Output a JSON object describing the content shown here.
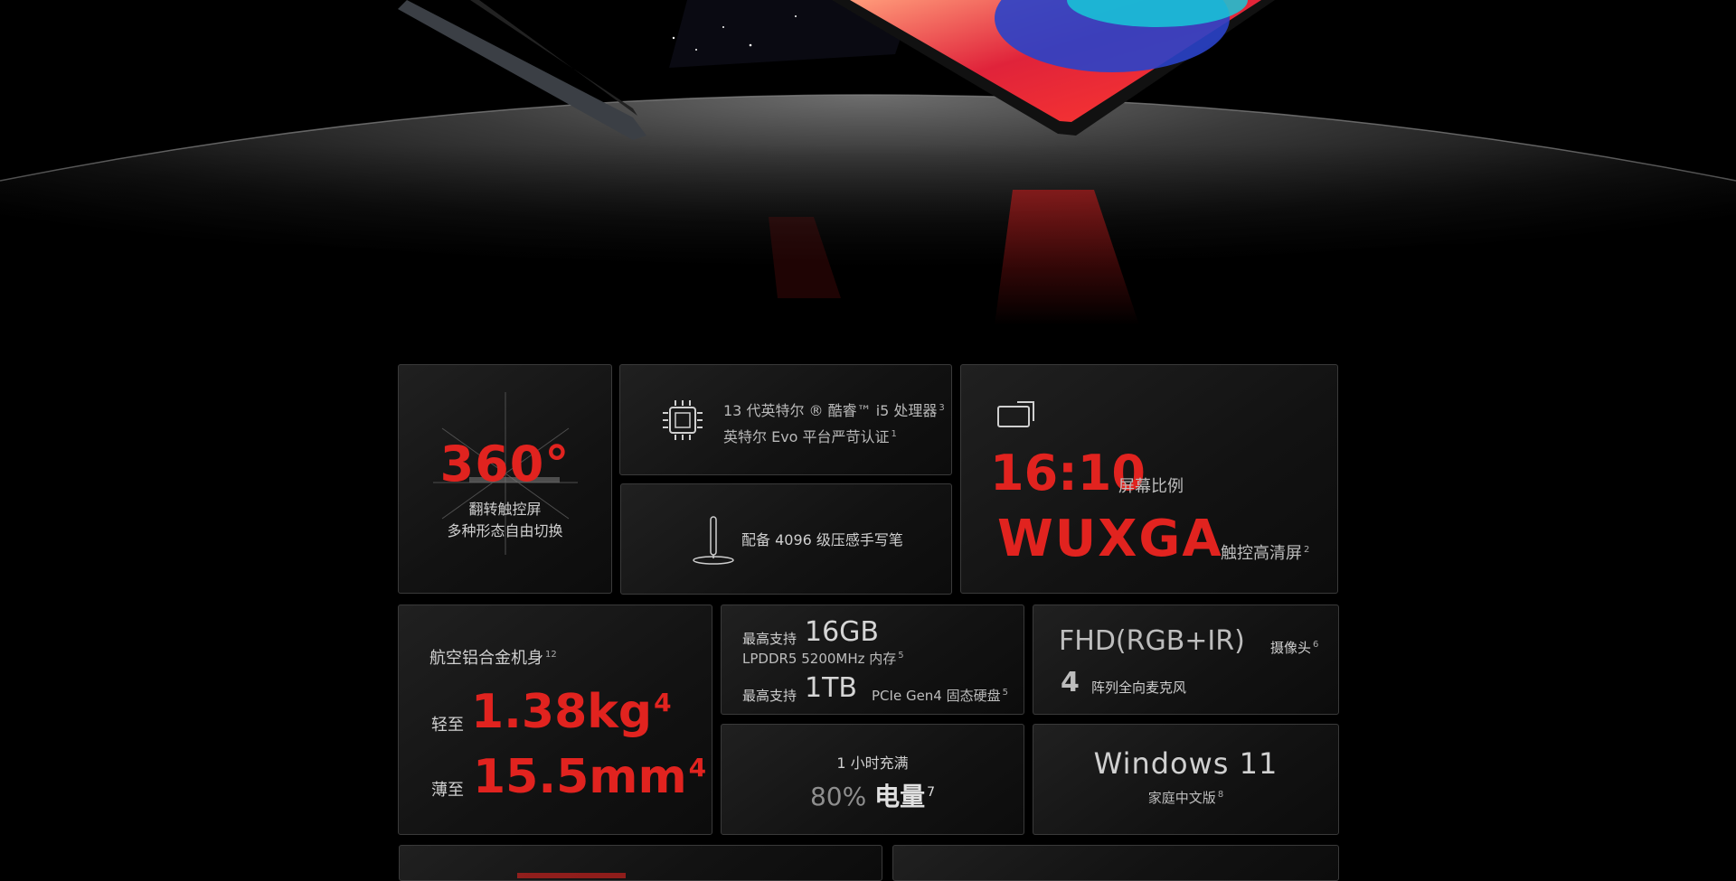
{
  "flip": {
    "value": "360°",
    "line1": "翻转触控屏",
    "line2": "多种形态自由切换"
  },
  "cpu": {
    "line1": "13 代英特尔 ® 酷睿™ i5 处理器",
    "line1_sup": "3",
    "line2": "英特尔 Evo 平台严苛认证",
    "line2_sup": "1"
  },
  "pen": {
    "label": "配备 4096 级压感手写笔"
  },
  "screen": {
    "ratio": "16:10",
    "ratio_label": "屏幕比例",
    "resolution": "WUXGA",
    "resolution_label": "触控高清屏",
    "resolution_sup": "2"
  },
  "body_spec": {
    "material": "航空铝合金机身",
    "material_sup": "12",
    "weight_prefix": "轻至",
    "weight": "1.38kg",
    "weight_sup": "4",
    "thickness_prefix": "薄至",
    "thickness": "15.5mm",
    "thickness_sup": "4"
  },
  "memory": {
    "ram_prefix": "最高支持",
    "ram_value": "16GB",
    "ram_detail": "LPDDR5 5200MHz 内存",
    "ram_sup": "5",
    "ssd_prefix": "最高支持",
    "ssd_value": "1TB",
    "ssd_detail": "PCIe Gen4 固态硬盘",
    "ssd_sup": "5"
  },
  "camera": {
    "cam_value": "FHD(RGB+IR)",
    "cam_label": "摄像头",
    "cam_sup": "6",
    "mic_value": "4",
    "mic_label": "阵列全向麦克风"
  },
  "charge": {
    "line1": "1 小时充满",
    "percent": "80%",
    "amount": "电量",
    "amount_sup": "7"
  },
  "os": {
    "name": "Windows 11",
    "edition": "家庭中文版",
    "edition_sup": "8"
  },
  "colors": {
    "accent_red": "#e1231f",
    "tile_border": "#3a3a3a",
    "background": "#000000"
  }
}
